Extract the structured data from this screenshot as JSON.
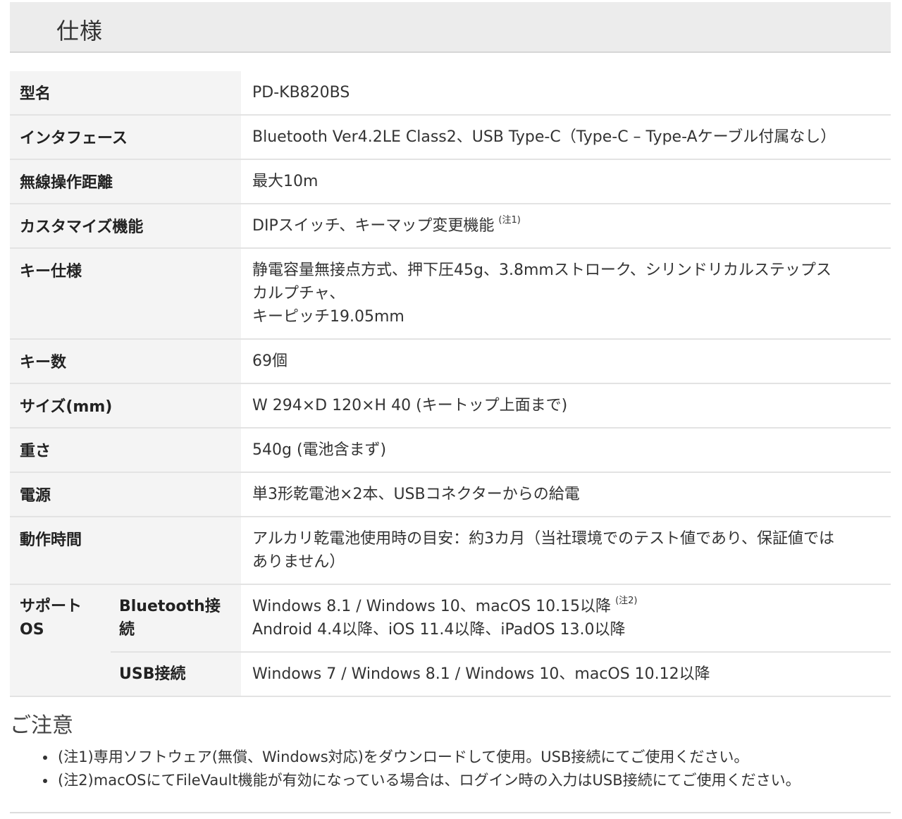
{
  "section_title": "仕様",
  "rows": [
    {
      "label": "型名",
      "value": "PD-KB820BS"
    },
    {
      "label": "インタフェース",
      "value": "Bluetooth Ver4.2LE Class2、USB Type-C（Type-C – Type-Aケーブル付属なし）"
    },
    {
      "label": "無線操作距離",
      "value": "最大10m"
    },
    {
      "label": "カスタマイズ機能",
      "value": "DIPスイッチ、キーマップ変更機能",
      "note": "(注1)"
    },
    {
      "label": "キー仕様",
      "value_line1": "静電容量無接点方式、押下圧45g、3.8mmストローク、シリンドリカルステップス",
      "value_line2": "カルプチャ、",
      "value_line3": "キーピッチ19.05mm"
    },
    {
      "label": "キー数",
      "value": "69個"
    },
    {
      "label": "サイズ(mm)",
      "value": "W 294×D 120×H 40 (キートップ上面まで)"
    },
    {
      "label": "重さ",
      "value": "540g (電池含まず)"
    },
    {
      "label": "電源",
      "value": "単3形乾電池×2本、USBコネクターからの給電"
    },
    {
      "label": "動作時間",
      "value_line1": "アルカリ乾電池使用時の目安：約3カ月（当社環境でのテスト値であり、保証値では",
      "value_line2": "ありません）"
    }
  ],
  "support_os": {
    "label_line1": "サポート",
    "label_line2": "OS",
    "bluetooth": {
      "label_line1": "Bluetooth接",
      "label_line2": "続",
      "value_line1": "Windows 8.1 / Windows 10、macOS 10.15以降",
      "note": "(注2)",
      "value_line2": "Android 4.4以降、iOS 11.4以降、iPadOS 13.0以降"
    },
    "usb": {
      "label": "USB接続",
      "value": "Windows 7 / Windows 8.1 / Windows 10、macOS 10.12以降"
    }
  },
  "notes_title": "ご注意",
  "notes": [
    "(注1)専用ソフトウェア(無償、Windows対応)をダウンロードして使用。USB接続にてご使用ください。",
    "(注2)macOSにてFileVault機能が有効になっている場合は、ログイン時の入力はUSB接続にてご使用ください。"
  ]
}
